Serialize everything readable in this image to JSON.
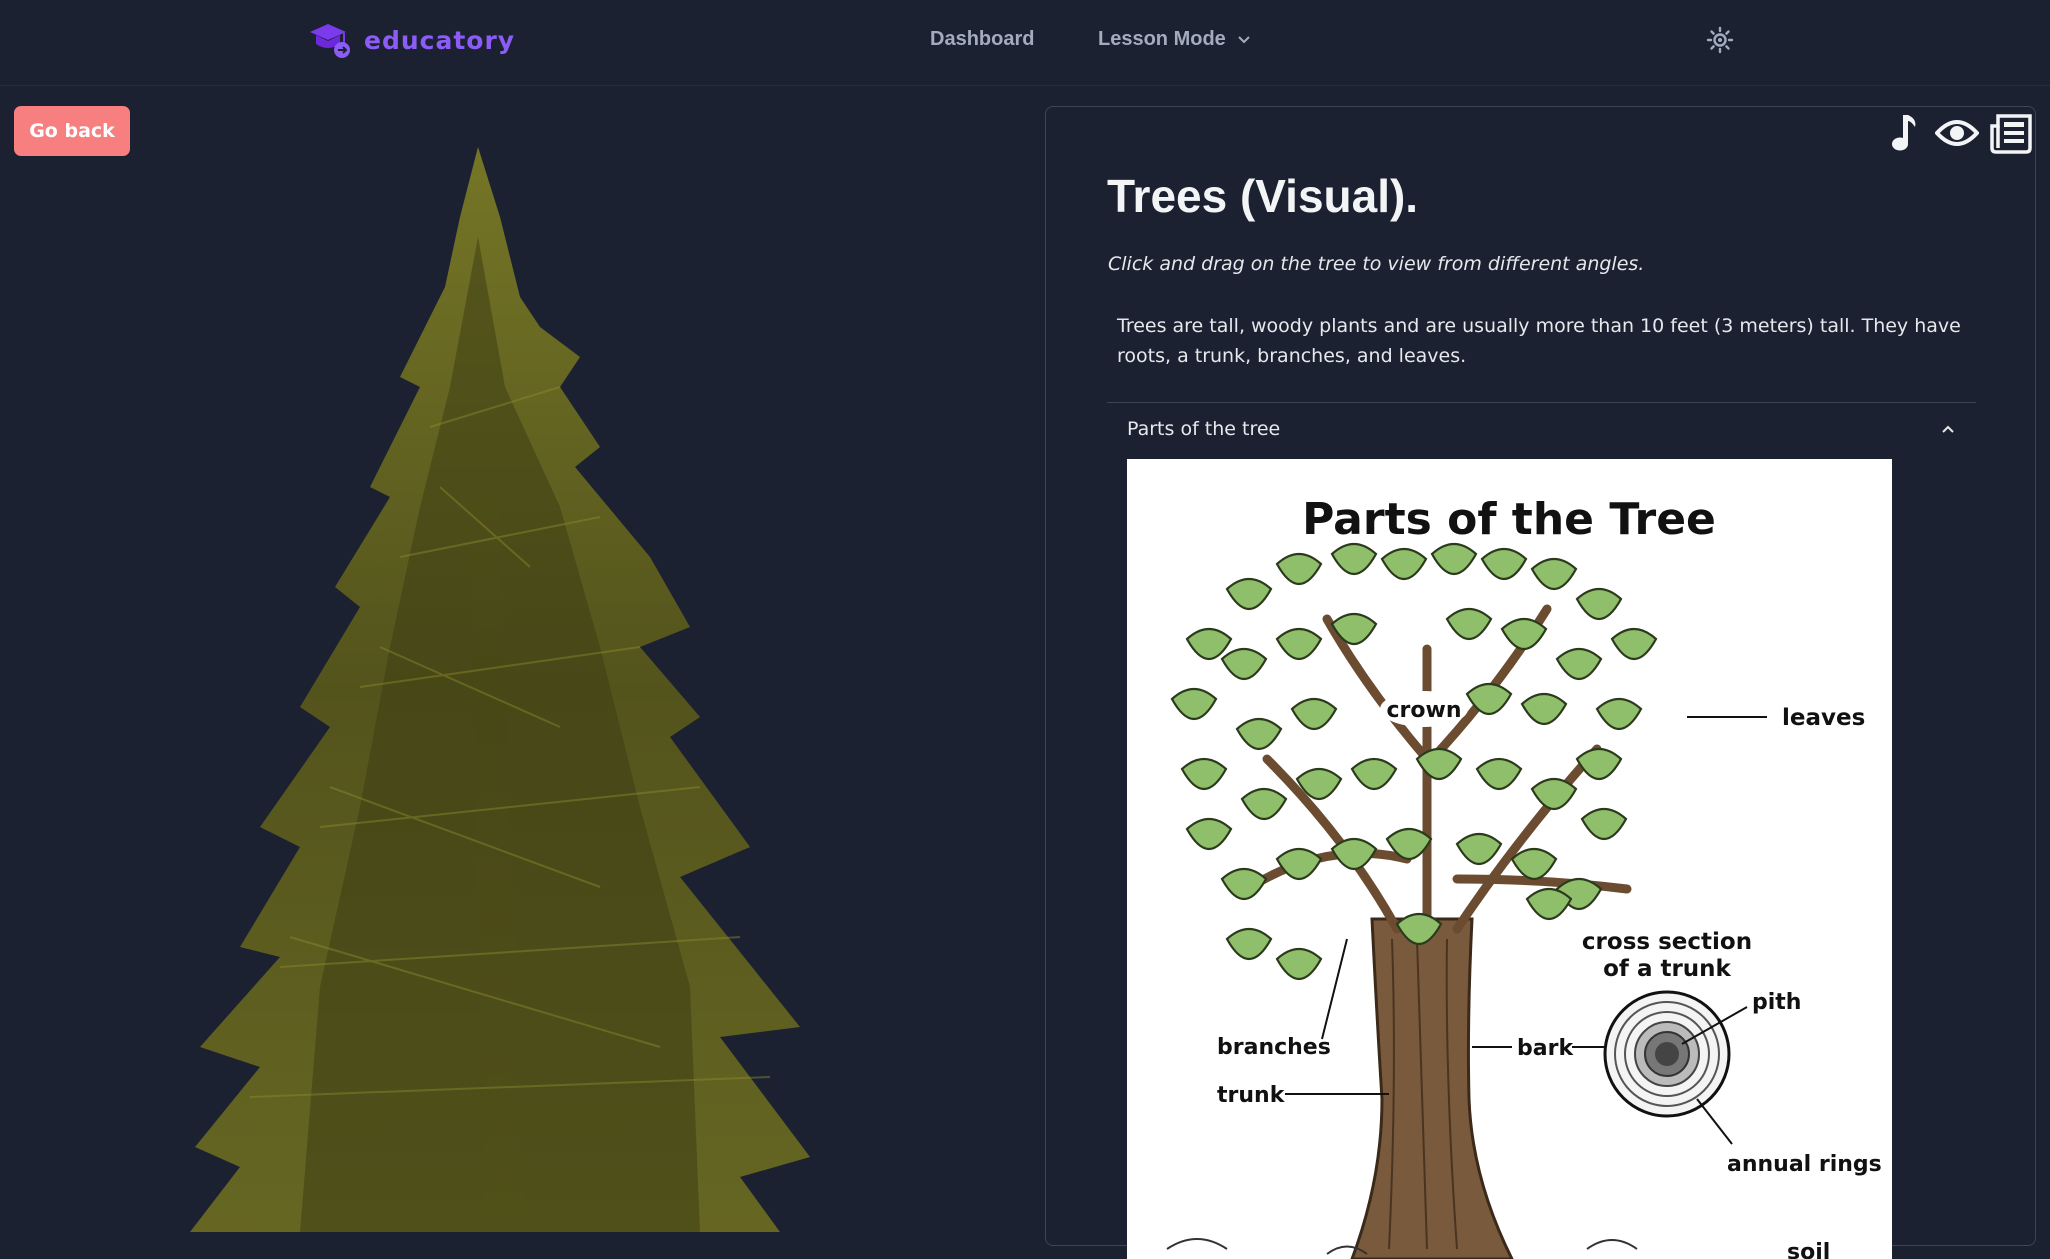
{
  "app": {
    "brand": "educatory",
    "nav": {
      "dashboard": "Dashboard",
      "lesson_mode": "Lesson Mode"
    },
    "icons": {
      "logo": "graduation-cap-icon",
      "theme": "sun-icon",
      "dropdown": "chevron-down-icon"
    }
  },
  "viewer": {
    "go_back_label": "Go back"
  },
  "panel": {
    "title": "Trees (Visual).",
    "hint": "Click and drag on the tree to view from different angles.",
    "description": "Trees are tall, woody plants and are usually more than 10 feet (3 meters) tall. They have roots, a trunk, branches, and leaves.",
    "tools": [
      "music-note-icon",
      "eye-icon",
      "newspaper-icon"
    ],
    "accordion": {
      "title": "Parts of the tree",
      "expanded": true,
      "diagram": {
        "heading": "Parts of the Tree",
        "labels": {
          "crown": "crown",
          "leaves": "leaves",
          "cross_section_1": "cross section",
          "cross_section_2": "of a trunk",
          "pith": "pith",
          "branches": "branches",
          "bark": "bark",
          "trunk": "trunk",
          "annual_rings": "annual rings",
          "soil": "soil"
        }
      }
    }
  },
  "colors": {
    "accent": "#8b5cf6",
    "go_back": "#f87f7f",
    "background": "#1b2130",
    "leaf": "#8fbf6a"
  }
}
